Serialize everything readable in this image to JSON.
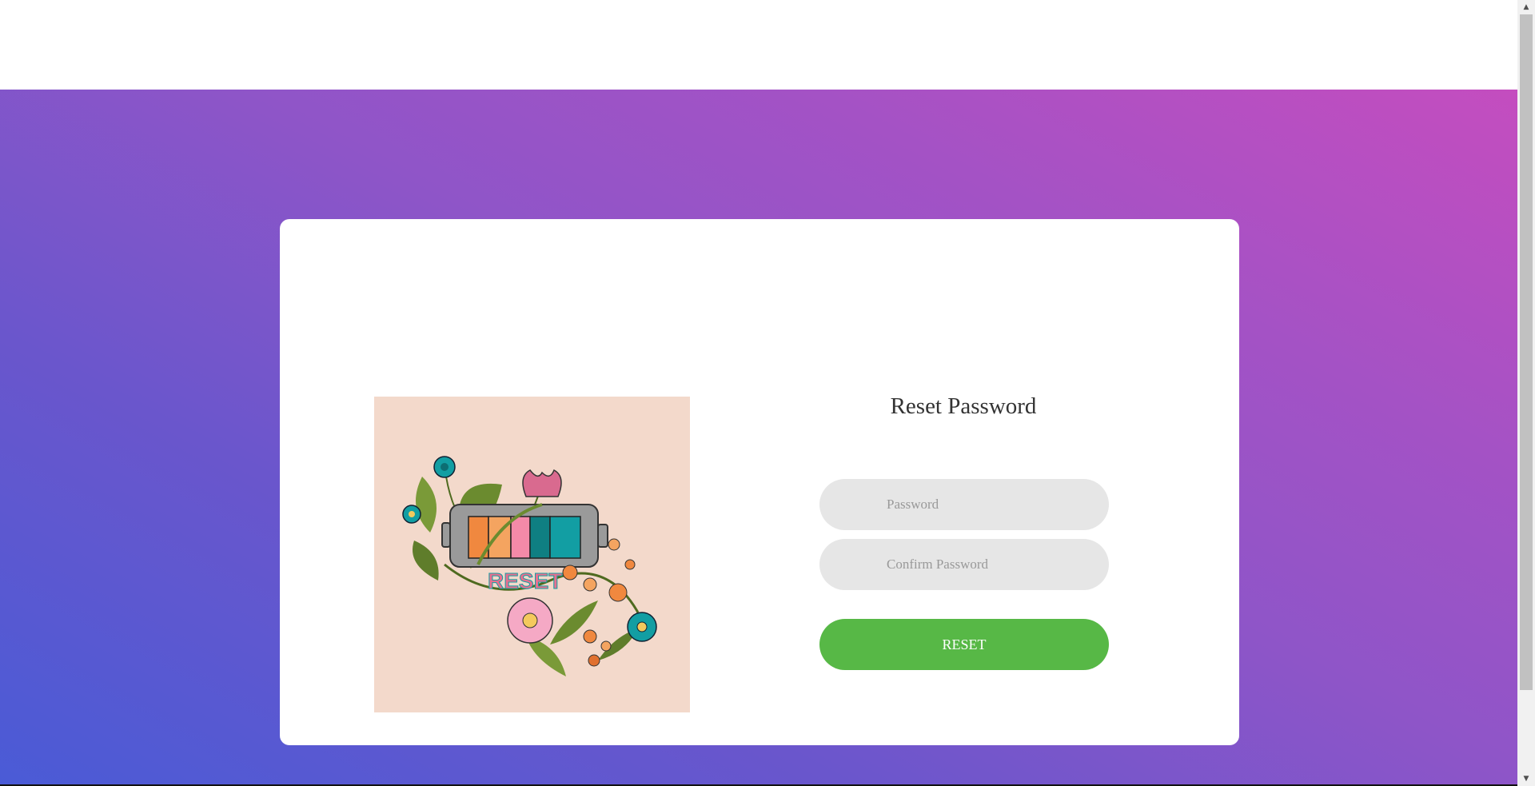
{
  "form": {
    "title": "Reset Password",
    "password_placeholder": "Password",
    "confirm_placeholder": "Confirm Password",
    "submit_label": "RESET"
  },
  "illustration": {
    "text": "RESET",
    "battery_colors": [
      "#f0883f",
      "#f4a460",
      "#f48aa8",
      "#0f7f82",
      "#129ea3"
    ]
  },
  "colors": {
    "gradient_start": "#4a5bd6",
    "gradient_end": "#c44dbf",
    "button": "#57b846",
    "input_bg": "#e6e6e6"
  },
  "icons": {
    "scroll_up": "▲",
    "scroll_down": "▼"
  }
}
